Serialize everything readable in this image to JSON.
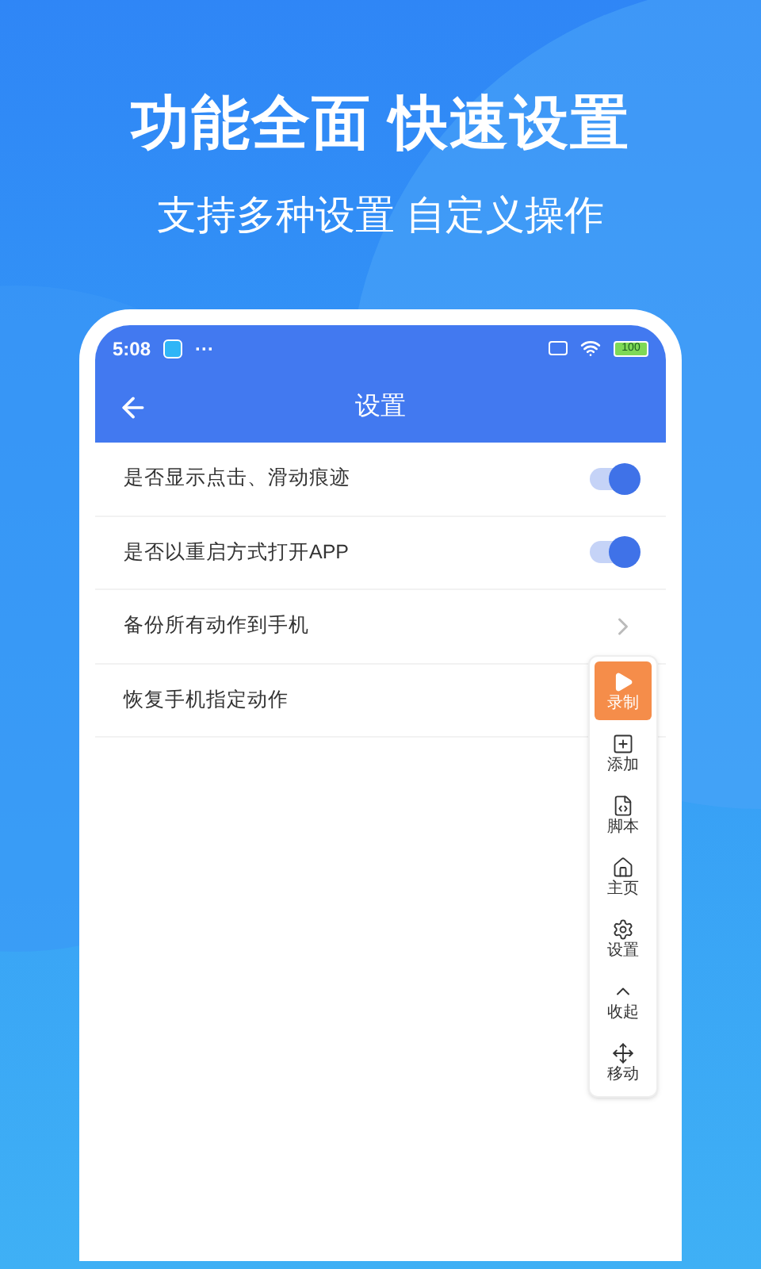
{
  "headline": "功能全面 快速设置",
  "subheadline": "支持多种设置 自定义操作",
  "status_bar": {
    "time": "5:08",
    "more": "···",
    "battery": "100"
  },
  "header": {
    "title": "设置"
  },
  "settings": [
    {
      "label": "是否显示点击、滑动痕迹",
      "kind": "toggle",
      "on": true
    },
    {
      "label": "是否以重启方式打开APP",
      "kind": "toggle",
      "on": true
    },
    {
      "label": "备份所有动作到手机",
      "kind": "link"
    },
    {
      "label": "恢复手机指定动作",
      "kind": "link"
    }
  ],
  "toolbar": [
    {
      "label": "录制",
      "kind": "record",
      "selected": true
    },
    {
      "label": "添加",
      "kind": "add",
      "selected": false
    },
    {
      "label": "脚本",
      "kind": "script",
      "selected": false
    },
    {
      "label": "主页",
      "kind": "home",
      "selected": false
    },
    {
      "label": "设置",
      "kind": "settings",
      "selected": false
    },
    {
      "label": "收起",
      "kind": "collapse",
      "selected": false
    },
    {
      "label": "移动",
      "kind": "move",
      "selected": false
    }
  ]
}
